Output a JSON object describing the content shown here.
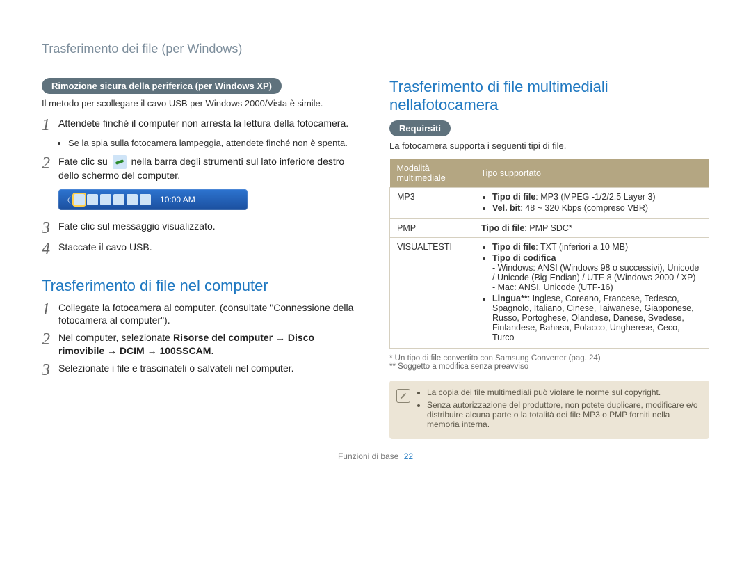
{
  "page_header": "Trasferimento dei file (per Windows)",
  "left": {
    "pill": "Rimozione sicura della periferica (per Windows XP)",
    "lead": "Il metodo per scollegare il cavo USB per Windows 2000/Vista è simile.",
    "steps": {
      "s1": "Attendete finché il computer non arresta la lettura della fotocamera.",
      "s1_bullet": "Se la spia sulla fotocamera lampeggia, attendete finché non è spenta.",
      "s2_a": "Fate clic su",
      "s2_b": "nella barra degli strumenti sul lato inferiore destro dello schermo del computer.",
      "s3": "Fate clic sul messaggio visualizzato.",
      "s4": "Staccate il cavo USB."
    },
    "taskbar_clock": "10:00 AM",
    "section2_title": "Trasferimento di file nel computer",
    "steps2": {
      "s1": "Collegate la fotocamera al computer. (consultate \"Connessione della fotocamera al computer\").",
      "s2_a": "Nel computer, selezionate ",
      "s2_bold": "Risorse del computer → Disco rimovibile → DCIM → 100SSCAM",
      "s2_suffix": ".",
      "s3": "Selezionate i file e trascinateli o salvateli nel computer."
    }
  },
  "right": {
    "section_title": "Trasferimento di file multimediali nellafotocamera",
    "pill": "Requirsiti",
    "intro": "La fotocamera supporta i seguenti tipi di file.",
    "th1": "Modalità multimediale",
    "th2": "Tipo supportato",
    "rows": {
      "mp3_label": "MP3",
      "mp3": {
        "b1_label": "Tipo di file",
        "b1_val": ": MP3 (MPEG -1/2/2.5 Layer 3)",
        "b2_label": "Vel. bit",
        "b2_val": ": 48 ~ 320 Kbps (compreso VBR)"
      },
      "pmp_label": "PMP",
      "pmp_label2": "Tipo di file",
      "pmp_val": ": PMP SDC*",
      "vt_label": "VISUALTESTI",
      "vt": {
        "b1_label": "Tipo di file",
        "b1_val": ": TXT (inferiori a 10 MB)",
        "b2_label": "Tipo di codifica",
        "enc_win": "- Windows: ANSI (Windows 98 o successivi), Unicode / Unicode (Big-Endian) / UTF-8 (Windows 2000 / XP)",
        "enc_mac": "- Mac: ANSI, Unicode (UTF-16)",
        "b3_label": "Lingua**",
        "b3_val": ": Inglese, Coreano, Francese, Tedesco, Spagnolo, Italiano, Cinese, Taiwanese, Giapponese, Russo, Portoghese, Olandese, Danese, Svedese, Finlandese, Bahasa, Polacco, Ungherese, Ceco, Turco"
      }
    },
    "foot1": "* Un tipo di file convertito con Samsung Converter (pag. 24)",
    "foot2": "** Soggetto a modifica senza preavviso",
    "note": {
      "b1": "La copia dei file multimediali può violare le norme sul copyright.",
      "b2": "Senza autorizzazione del produttore, non potete duplicare, modificare e/o distribuire alcuna parte o la totalità dei file MP3 o PMP forniti nella memoria interna."
    }
  },
  "footer_label": "Funzioni di base",
  "footer_page": "22",
  "chart_data": {
    "type": "table",
    "title": "Tipi di file multimediali supportati",
    "columns": [
      "Modalità multimediale",
      "Tipo supportato"
    ],
    "rows": [
      {
        "Modalità multimediale": "MP3",
        "Tipo supportato": "Tipo di file: MP3 (MPEG -1/2/2.5 Layer 3); Vel. bit: 48 ~ 320 Kbps (compreso VBR)"
      },
      {
        "Modalità multimediale": "PMP",
        "Tipo supportato": "Tipo di file: PMP SDC*"
      },
      {
        "Modalità multimediale": "VISUALTESTI",
        "Tipo supportato": "Tipo di file: TXT (inferiori a 10 MB); Tipo di codifica — Windows: ANSI (Windows 98 o successivi), Unicode / Unicode (Big-Endian) / UTF-8 (Windows 2000 / XP); Mac: ANSI, Unicode (UTF-16); Lingua**: Inglese, Coreano, Francese, Tedesco, Spagnolo, Italiano, Cinese, Taiwanese, Giapponese, Russo, Portoghese, Olandese, Danese, Svedese, Finlandese, Bahasa, Polacco, Ungherese, Ceco, Turco"
      }
    ]
  }
}
